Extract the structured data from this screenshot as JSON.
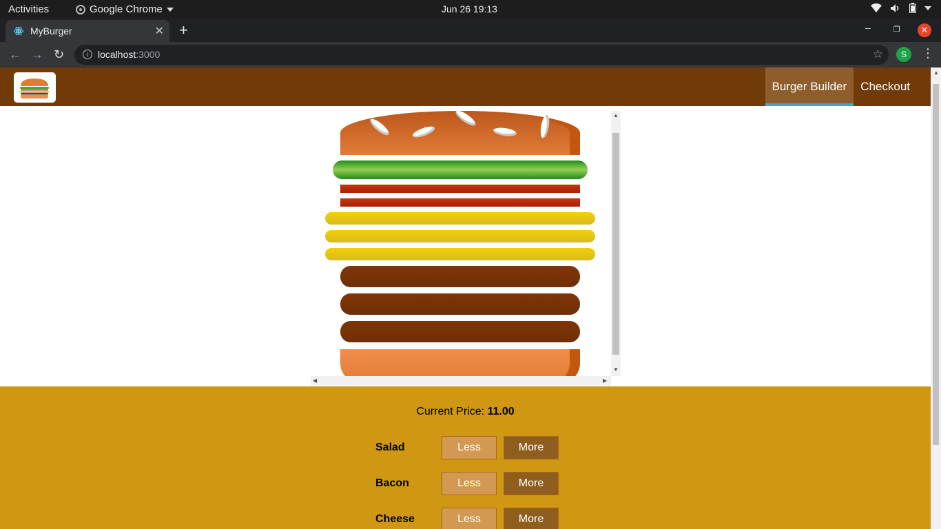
{
  "os": {
    "activities": "Activities",
    "app_name": "Google Chrome",
    "clock": "Jun 26  19:13"
  },
  "browser": {
    "tab_title": "MyBurger",
    "url_host": "localhost",
    "url_port": ":3000",
    "profile_initial": "S"
  },
  "app": {
    "nav": [
      {
        "label": "Burger Builder",
        "active": true
      },
      {
        "label": "Checkout",
        "active": false
      }
    ],
    "burger": {
      "layers": [
        "salad",
        "bacon",
        "bacon",
        "cheese",
        "cheese",
        "cheese",
        "meat",
        "meat",
        "meat"
      ]
    },
    "price_label": "Current Price:",
    "price_value": "11.00",
    "controls": [
      {
        "label": "Salad",
        "less": "Less",
        "more": "More"
      },
      {
        "label": "Bacon",
        "less": "Less",
        "more": "More"
      },
      {
        "label": "Cheese",
        "less": "Less",
        "more": "More"
      }
    ]
  },
  "colors": {
    "header": "#703b09",
    "active_nav": "#8f5c2c",
    "active_underline": "#40a4c8",
    "controls_bg": "#cf9713"
  }
}
